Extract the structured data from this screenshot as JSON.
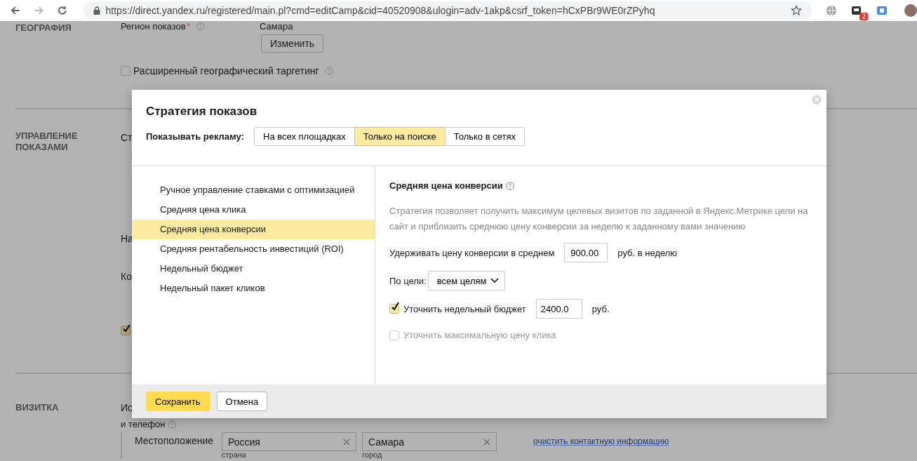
{
  "browser": {
    "url": "https://direct.yandex.ru/registered/main.pl?cmd=editCamp&cid=40520908&ulogin=adv-1akp&csrf_token=hCxPBr9WE0rZPyhq",
    "extension_badge": "2"
  },
  "geography": {
    "heading": "ГЕОГРАФИЯ",
    "region_label": "Регион показов",
    "required_mark": "*",
    "region_value": "Самара",
    "change_button": "Изменить",
    "extended_targeting": {
      "label": "Расширенный географический таргетинг",
      "checked": false
    }
  },
  "display_management": {
    "heading": "УПРАВЛЕНИЕ ПОКАЗАМИ",
    "fragments": [
      "Ст",
      "На",
      "Ко"
    ],
    "checkbox_checked": true
  },
  "business_card": {
    "heading": "ВИЗИТКА",
    "fragment": "Ис",
    "fragment_line_2": "и телефон",
    "location_label": "Местоположение",
    "fields": [
      {
        "value": "Россия",
        "caption": "страна"
      },
      {
        "value": "Самара",
        "caption": "город"
      }
    ],
    "clear_link": "очистить контактную информацию"
  },
  "modal": {
    "title": "Стратегия показов",
    "show_ads_label": "Показывать рекламу:",
    "placements": [
      {
        "label": "На всех площадках",
        "selected": false
      },
      {
        "label": "Только на поиске",
        "selected": true
      },
      {
        "label": "Только в сетях",
        "selected": false
      }
    ],
    "strategies": [
      {
        "label": "Ручное управление ставками с оптимизацией",
        "selected": false
      },
      {
        "label": "Средняя цена клика",
        "selected": false
      },
      {
        "label": "Средняя цена конверсии",
        "selected": true
      },
      {
        "label": "Средняя рентабельность инвестиций (ROI)",
        "selected": false
      },
      {
        "label": "Недельный бюджет",
        "selected": false
      },
      {
        "label": "Недельный пакет кликов",
        "selected": false
      }
    ],
    "detail": {
      "title": "Средняя цена конверсии",
      "description": "Стратегия позволяет получить максимум целевых визитов по заданной в Яндекс.Метрике цели на сайт и приблизить среднюю цену конверсии за неделю к заданному вами значению",
      "price_label": "Удерживать цену конверсии в среднем",
      "price_value": "900.00",
      "price_unit": "руб. в неделю",
      "goal_label": "По цели:",
      "goal_value": "всем целям",
      "options": [
        {
          "label": "Уточнить недельный бюджет",
          "checked": true,
          "disabled": false,
          "value": "2400.0",
          "unit": "руб."
        },
        {
          "label": "Уточнить максимальную цену клика",
          "checked": false,
          "disabled": true
        }
      ]
    },
    "buttons": [
      {
        "label": "Сохранить",
        "kind": "primary"
      },
      {
        "label": "Отмена",
        "kind": "secondary"
      }
    ]
  }
}
